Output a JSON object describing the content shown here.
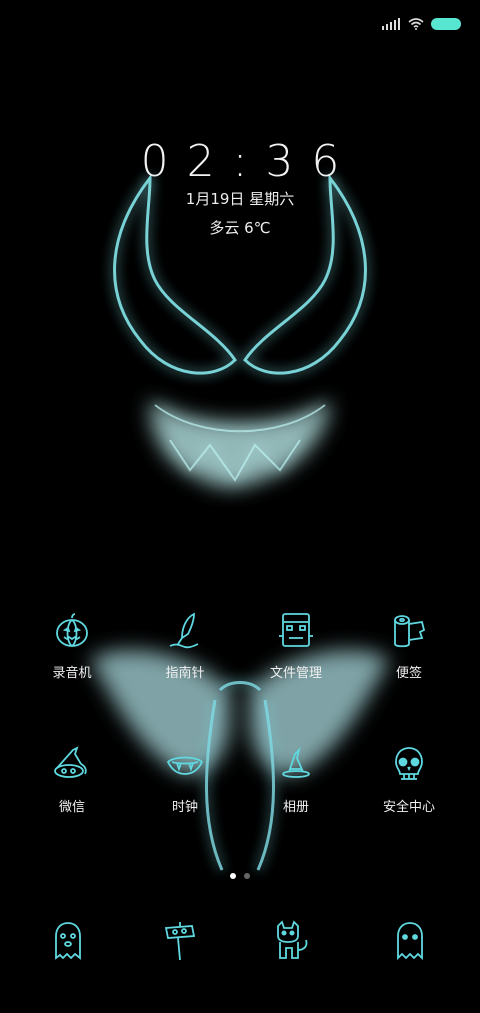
{
  "status": {
    "battery_color": "#59e6d1"
  },
  "lock": {
    "time": "02:36",
    "date": "1月19日 星期六",
    "weather": "多云 6℃"
  },
  "apps": [
    {
      "label": "录音机",
      "icon": "pumpkin-icon"
    },
    {
      "label": "指南针",
      "icon": "feather-quill-icon"
    },
    {
      "label": "文件管理",
      "icon": "frankenstein-icon"
    },
    {
      "label": "便签",
      "icon": "toilet-paper-icon"
    },
    {
      "label": "微信",
      "icon": "witch-hat-icon"
    },
    {
      "label": "时钟",
      "icon": "vampire-mouth-icon"
    },
    {
      "label": "相册",
      "icon": "witch-hat-small-icon"
    },
    {
      "label": "安全中心",
      "icon": "skull-icon"
    }
  ],
  "dock": [
    {
      "icon": "ghost-icon"
    },
    {
      "icon": "signpost-icon"
    },
    {
      "icon": "black-cat-icon"
    },
    {
      "icon": "ghost-sheet-icon"
    }
  ],
  "theme": {
    "accent": "#6fe3e6",
    "icon_stroke": "#5fd8e0"
  }
}
